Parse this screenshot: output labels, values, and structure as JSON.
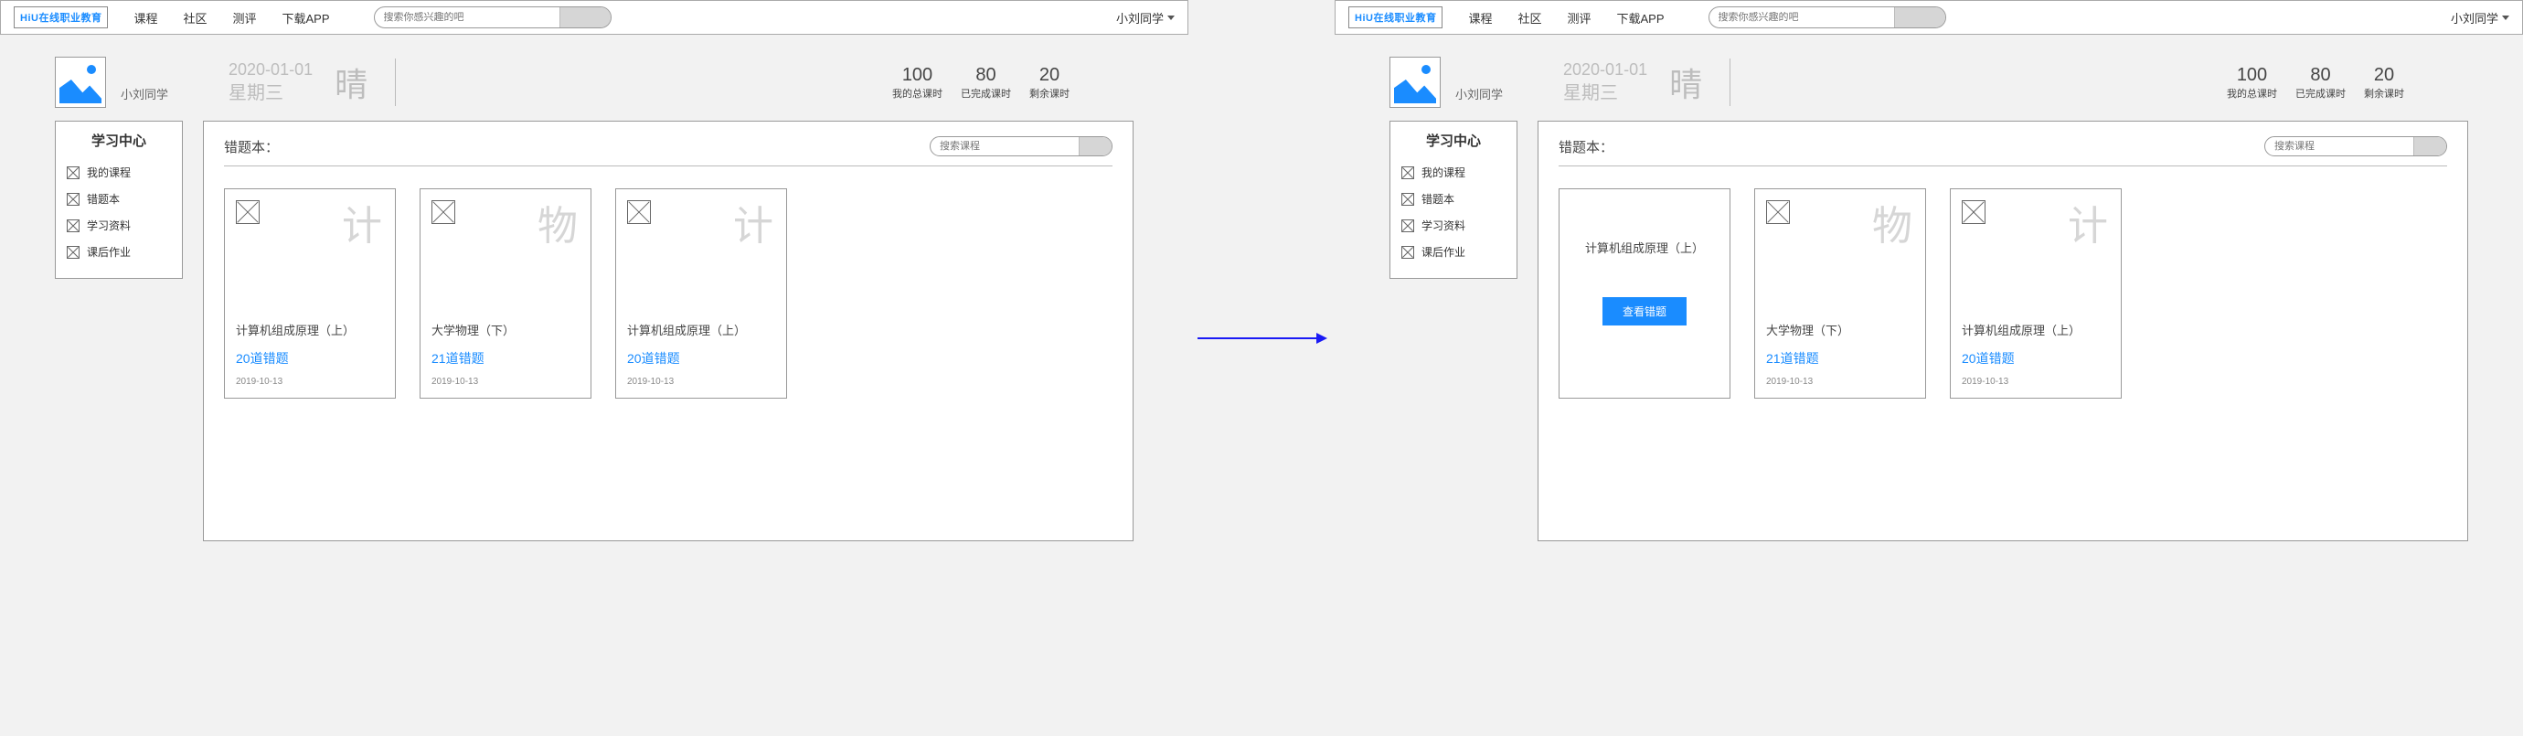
{
  "logo_text": "HiU在线职业教育",
  "nav": [
    "课程",
    "社区",
    "测评",
    "下载APP"
  ],
  "top_search_placeholder": "搜索你感兴趣的吧",
  "user_name": "小刘同学",
  "profile": {
    "name": "小刘同学",
    "date": "2020-01-01",
    "weekday": "星期三",
    "weather": "晴"
  },
  "stats": [
    {
      "num": "100",
      "lbl": "我的总课时"
    },
    {
      "num": "80",
      "lbl": "已完成课时"
    },
    {
      "num": "20",
      "lbl": "剩余课时"
    }
  ],
  "sidemenu": {
    "title": "学习中心",
    "items": [
      "我的课程",
      "错题本",
      "学习资料",
      "课后作业"
    ]
  },
  "panel": {
    "title": "错题本：",
    "search_placeholder": "搜索课程"
  },
  "cards": [
    {
      "bigchar": "计",
      "title": "计算机组成原理（上）",
      "count": "20道错题",
      "date": "2019-10-13"
    },
    {
      "bigchar": "物",
      "title": "大学物理（下）",
      "count": "21道错题",
      "date": "2019-10-13"
    },
    {
      "bigchar": "计",
      "title": "计算机组成原理（上）",
      "count": "20道错题",
      "date": "2019-10-13"
    }
  ],
  "hover_button": "查看错题"
}
